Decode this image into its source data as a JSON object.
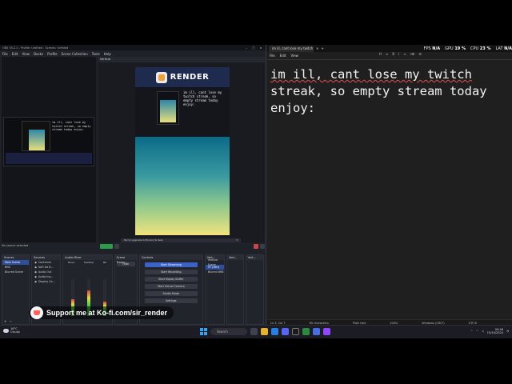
{
  "obs": {
    "title": "OBS 30.2.2 - Profile: Untitled - Scenes: Untitled",
    "menu": [
      "File",
      "Edit",
      "View",
      "Docks",
      "Profile",
      "Scene Collection",
      "Tools",
      "Help"
    ],
    "vertical_label": "Vertical",
    "canvas_brand": "RENDER",
    "canvas_chat": "im ill, cant lose my twitch streak, so empty stream today enjoy:",
    "canvas_caption": "Ferro [upgrade to Brown] & Sale",
    "no_source_text": "No source selected",
    "scenes_title": "Scenes",
    "scenes": [
      "Main Scene",
      "BRB",
      "Blurred Scene"
    ],
    "sources_title": "Sources",
    "sources": [
      "Container",
      "KoFi Ad D...",
      "Audio Out",
      "Audio Inp...",
      "Display Ca..."
    ],
    "mixer_title": "Audio Mixer",
    "mixer_channels": [
      "Music",
      "Desktop",
      "Mic"
    ],
    "mixer_levels": [
      0.45,
      0.7,
      0.4
    ],
    "transitions_title": "Scene Transi...",
    "transition_value": "Fade",
    "controls_title": "Controls",
    "controls": [
      "Start Streaming",
      "Start Recording",
      "Start Replay Buffer",
      "Start Virtual Camera",
      "Studio Mode",
      "Settings",
      "Exit"
    ],
    "vert_scenes_title": "Vert...",
    "vert_scenes": [
      "Vertical Scene",
      "VT (Vert)",
      "Blurred BRB"
    ],
    "vert_sources_title": "Vert...",
    "vert_mixer_title": "Vert...",
    "status": [
      "00:00:00",
      "00:00:00",
      "CPU: 0.3%",
      "30.00 / 30.00 FPS"
    ]
  },
  "kofi": {
    "text": "Support me at Ko-fi.com/sir_render"
  },
  "notepad": {
    "tab_title": "im ill, cant lose my twitch streak,",
    "stats": [
      {
        "label": "FPS",
        "value": "N/A"
      },
      {
        "label": "GPU",
        "value": "19 %"
      },
      {
        "label": "CPU",
        "value": "23 %"
      },
      {
        "label": "LAT",
        "value": "N/A"
      }
    ],
    "menu": [
      "File",
      "Edit",
      "View"
    ],
    "content_lines": [
      "im ill, cant lose my twitch",
      "streak, so empty stream today",
      "enjoy:"
    ],
    "status": [
      "Ln 3, Col 7",
      "65 characters",
      "Plain text",
      "100%",
      "Windows (CRLF)",
      "UTF-8"
    ]
  },
  "taskbar": {
    "weather_temp": "16°C",
    "weather_desc": "Cloudy",
    "search_placeholder": "Search",
    "time": "09:48",
    "date": "15/10/2024"
  },
  "colors": {
    "accent": "#3b62c4",
    "stream_green": "#2c9c4a",
    "kofi_red": "#ff5e5b"
  }
}
